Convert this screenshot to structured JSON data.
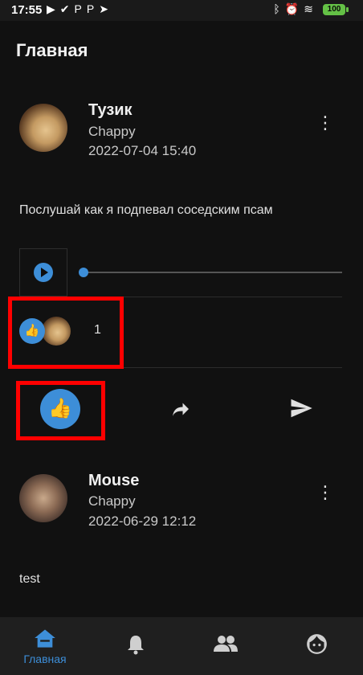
{
  "status_bar": {
    "time": "17:55",
    "notification_icons": [
      "play-icon",
      "check-circle-icon",
      "p-icon",
      "p-icon",
      "telegram-icon"
    ],
    "system_icons": [
      "bluetooth-icon",
      "alarm-icon",
      "wifi-icon"
    ],
    "battery": "100"
  },
  "appbar": {
    "title": "Главная"
  },
  "posts": [
    {
      "author": "Тузик",
      "group": "Chappy",
      "date": "2022-07-04 15:40",
      "text": "Послушай как я подпевал соседским псам",
      "audio_progress": 0,
      "likes_count": "1",
      "liked": true
    },
    {
      "author": "Mouse",
      "group": "Chappy",
      "date": "2022-06-29 12:12",
      "text": "test"
    }
  ],
  "bottom_nav": {
    "items": [
      {
        "label": "Главная",
        "icon": "home-icon",
        "active": true
      },
      {
        "label": "",
        "icon": "bell-icon",
        "active": false
      },
      {
        "label": "",
        "icon": "people-icon",
        "active": false
      },
      {
        "label": "",
        "icon": "face-icon",
        "active": false
      }
    ]
  },
  "colors": {
    "accent": "#3d8ed8",
    "highlight": "#ff0000",
    "background": "#111111",
    "nav_background": "#1f1f1f"
  }
}
